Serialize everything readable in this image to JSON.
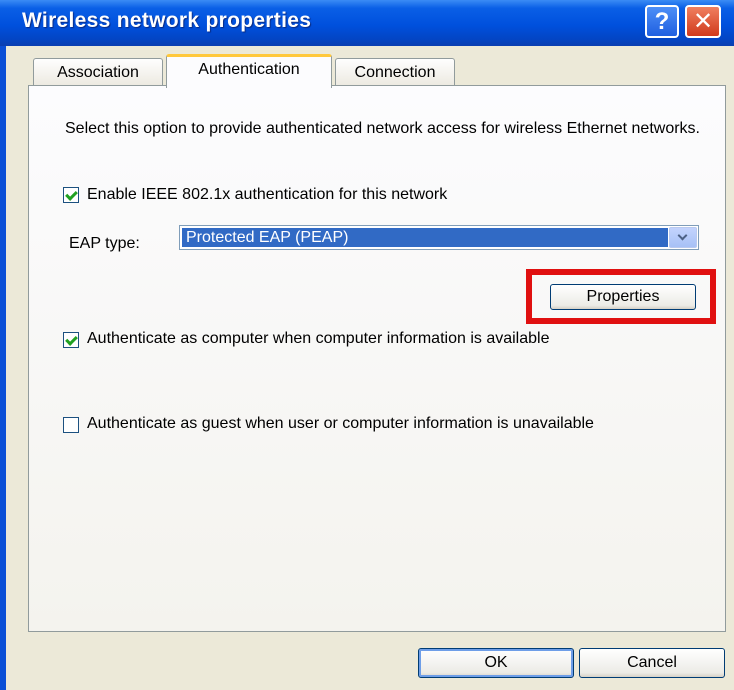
{
  "window": {
    "title": "Wireless network properties"
  },
  "titlebar": {
    "help_glyph": "?",
    "close_glyph": "✕"
  },
  "tabs": [
    {
      "label": "Association"
    },
    {
      "label": "Authentication",
      "selected": true
    },
    {
      "label": "Connection"
    }
  ],
  "panel": {
    "description": "Select this option to provide authenticated network access for wireless Ethernet networks.",
    "enable_8021x": {
      "label": "Enable IEEE 802.1x authentication for this network",
      "checked": true
    },
    "eap_type": {
      "label": "EAP type:",
      "value": "Protected EAP (PEAP)"
    },
    "properties_button": "Properties",
    "auth_computer": {
      "label": "Authenticate as computer when computer information is available",
      "checked": true
    },
    "auth_guest": {
      "label": "Authenticate as guest when user or computer information is unavailable",
      "checked": false
    }
  },
  "buttons": {
    "ok": "OK",
    "cancel": "Cancel"
  },
  "colors": {
    "title_bar": "#0050dd",
    "highlight": "#e01010",
    "dialog_bg": "#ece9d8"
  }
}
